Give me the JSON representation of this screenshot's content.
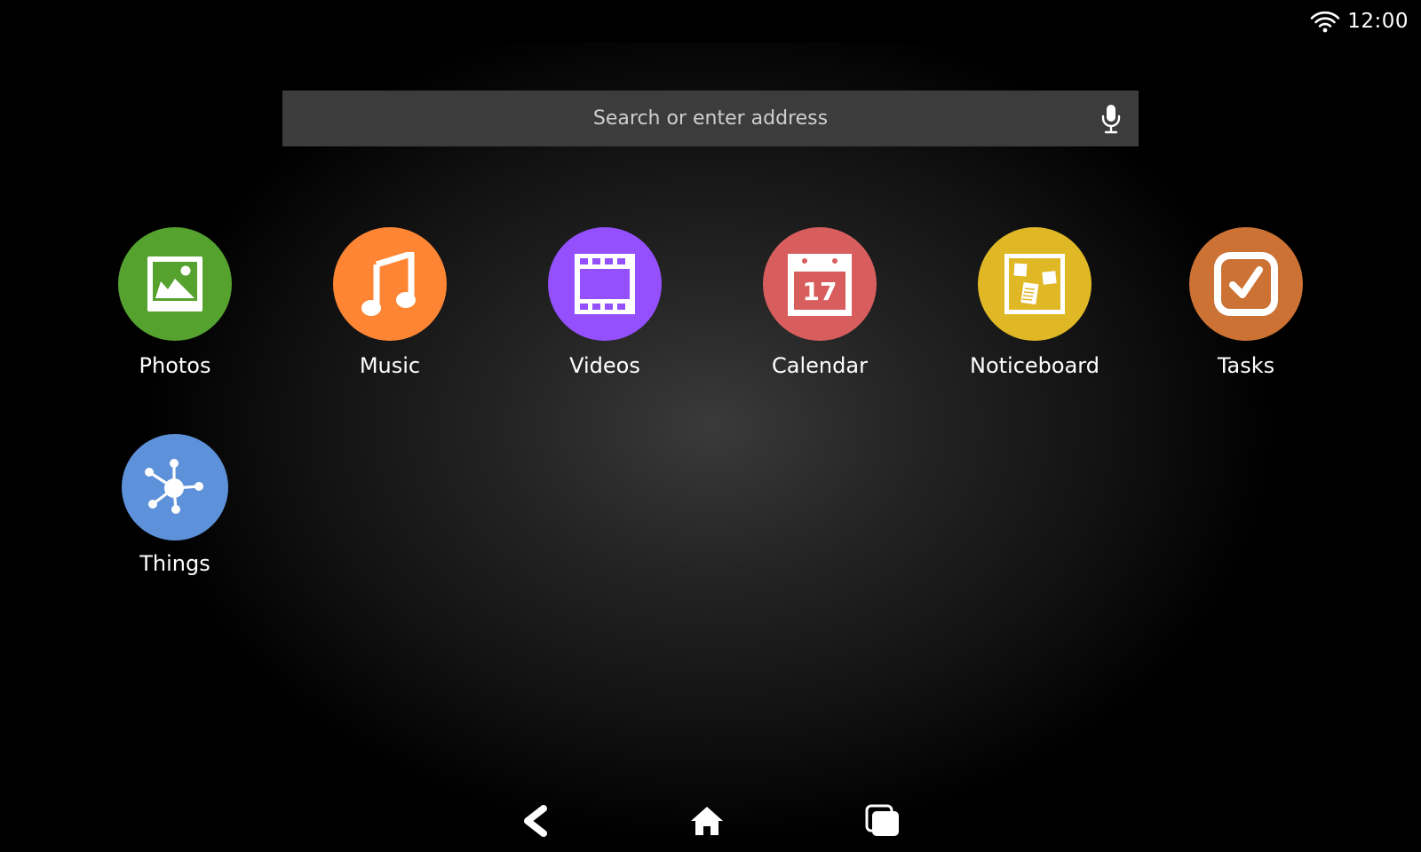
{
  "status_bar": {
    "time": "12:00",
    "wifi_icon": "wifi-icon"
  },
  "search": {
    "placeholder": "Search or enter address",
    "mic_icon": "microphone-icon"
  },
  "apps": [
    {
      "label": "Photos",
      "icon": "photos-icon",
      "color": "#55a22f"
    },
    {
      "label": "Music",
      "icon": "music-note-icon",
      "color": "#fd8534"
    },
    {
      "label": "Videos",
      "icon": "film-strip-icon",
      "color": "#9350fc"
    },
    {
      "label": "Calendar",
      "icon": "calendar-icon",
      "color": "#d85e5e",
      "badge": "17"
    },
    {
      "label": "Noticeboard",
      "icon": "noticeboard-icon",
      "color": "#e0b826"
    },
    {
      "label": "Tasks",
      "icon": "checkbox-icon",
      "color": "#cd7235"
    },
    {
      "label": "Things",
      "icon": "connected-nodes-icon",
      "color": "#5d91da"
    }
  ],
  "nav": {
    "back_icon": "back-icon",
    "home_icon": "home-icon",
    "recents_icon": "recents-icon"
  }
}
